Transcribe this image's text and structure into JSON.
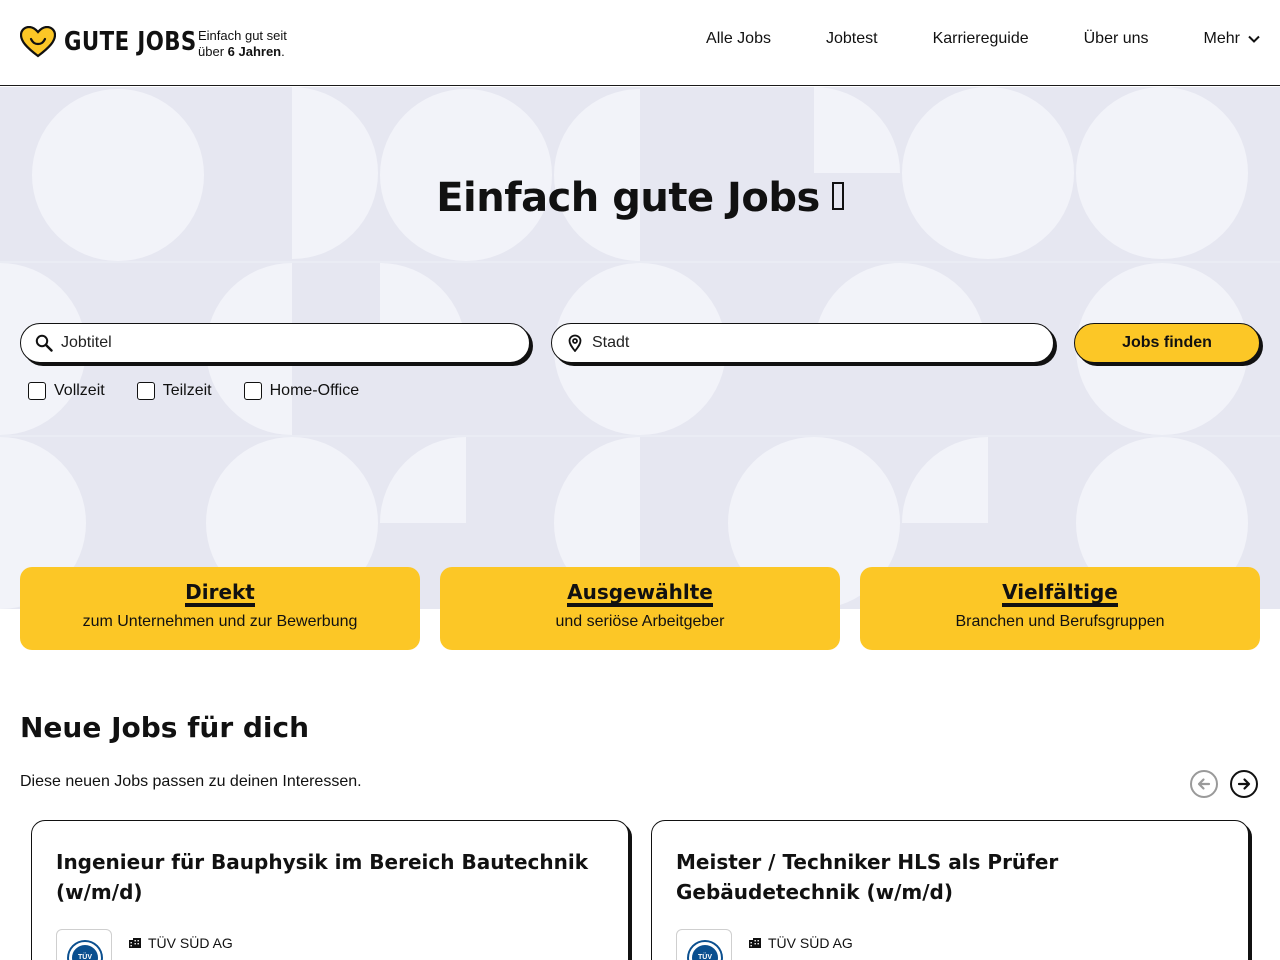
{
  "header": {
    "logo_text": "GUTE JOBS",
    "tagline_line1": "Einfach gut seit",
    "tagline_prefix": "über ",
    "tagline_bold": "6 Jahren",
    "tagline_suffix": ".",
    "nav": [
      {
        "label": "Alle Jobs"
      },
      {
        "label": "Jobtest"
      },
      {
        "label": "Karriereguide"
      },
      {
        "label": "Über uns"
      },
      {
        "label": "Mehr",
        "icon": "chevron-down-icon"
      }
    ]
  },
  "hero": {
    "title": "Einfach gute Jobs",
    "search": {
      "job_placeholder": "Jobtitel",
      "location_placeholder": "Stadt",
      "button_label": "Jobs finden"
    },
    "filters": [
      {
        "label": "Vollzeit",
        "checked": false
      },
      {
        "label": "Teilzeit",
        "checked": false
      },
      {
        "label": "Home-Office",
        "checked": false
      }
    ]
  },
  "features": [
    {
      "title": "Direkt",
      "subtitle": "zum Unternehmen und zur Bewerbung"
    },
    {
      "title": "Ausgewählte",
      "subtitle": "und seriöse Arbeitgeber"
    },
    {
      "title": "Vielfältige",
      "subtitle": "Branchen und Berufsgruppen"
    }
  ],
  "new_jobs": {
    "title": "Neue Jobs für dich",
    "subtitle": "Diese neuen Jobs passen zu deinen Interessen.",
    "jobs": [
      {
        "title": "Ingenieur für Bauphysik im Bereich Bautechnik (w/m/d)",
        "company": "TÜV SÜD AG"
      },
      {
        "title": "Meister / Techniker HLS als Prüfer Gebäudetechnik (w/m/d)",
        "company": "TÜV SÜD AG"
      }
    ]
  },
  "colors": {
    "accent": "#fcc726",
    "hero_bg": "#e6e7f1",
    "text": "#111111"
  }
}
